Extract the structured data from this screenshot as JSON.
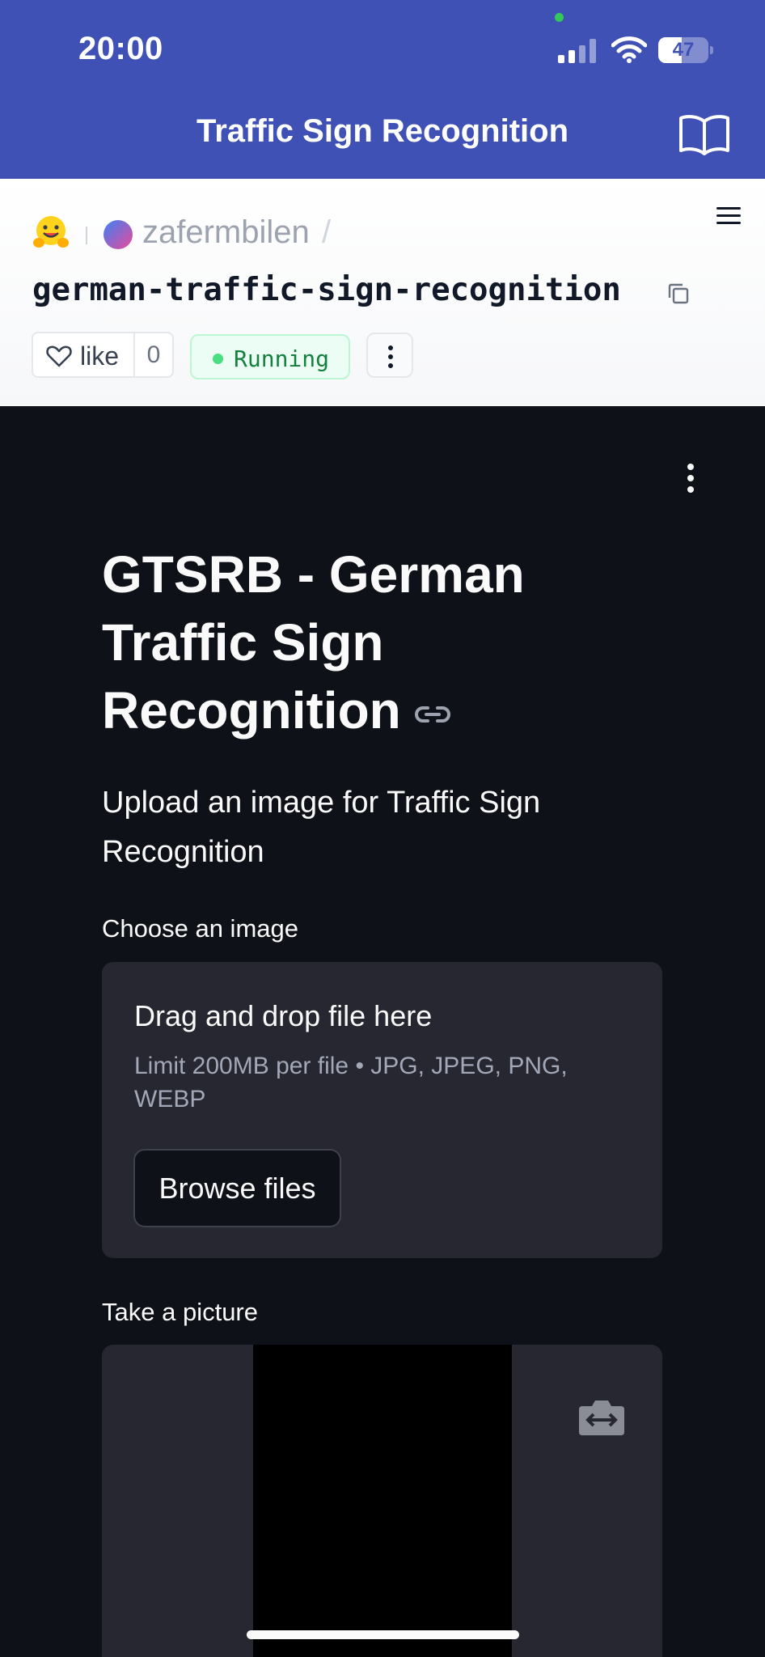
{
  "status_bar": {
    "time": "20:00",
    "battery_level": "47",
    "battery_fraction": 0.47
  },
  "nav": {
    "title": "Traffic Sign Recognition",
    "icons": [
      "book-icon"
    ]
  },
  "space": {
    "owner": "zafermbilen",
    "separator": "/",
    "repo": "german-traffic-sign-recognition",
    "like_label": "like",
    "like_count": "0",
    "status": "Running",
    "status_color": "#4ade80"
  },
  "app": {
    "title": "GTSRB - German Traffic Sign Recognition",
    "description": "Upload an image for Traffic Sign Recognition",
    "uploader": {
      "label": "Choose an image",
      "drop_title": "Drag and drop file here",
      "limit": "Limit 200MB per file • JPG, JPEG, PNG, WEBP",
      "button": "Browse files"
    },
    "camera": {
      "label": "Take a picture"
    }
  },
  "colors": {
    "nav_bg": "#3f51b5",
    "app_bg": "#0e1117",
    "widget_bg": "#262730",
    "text": "#fafafa"
  }
}
